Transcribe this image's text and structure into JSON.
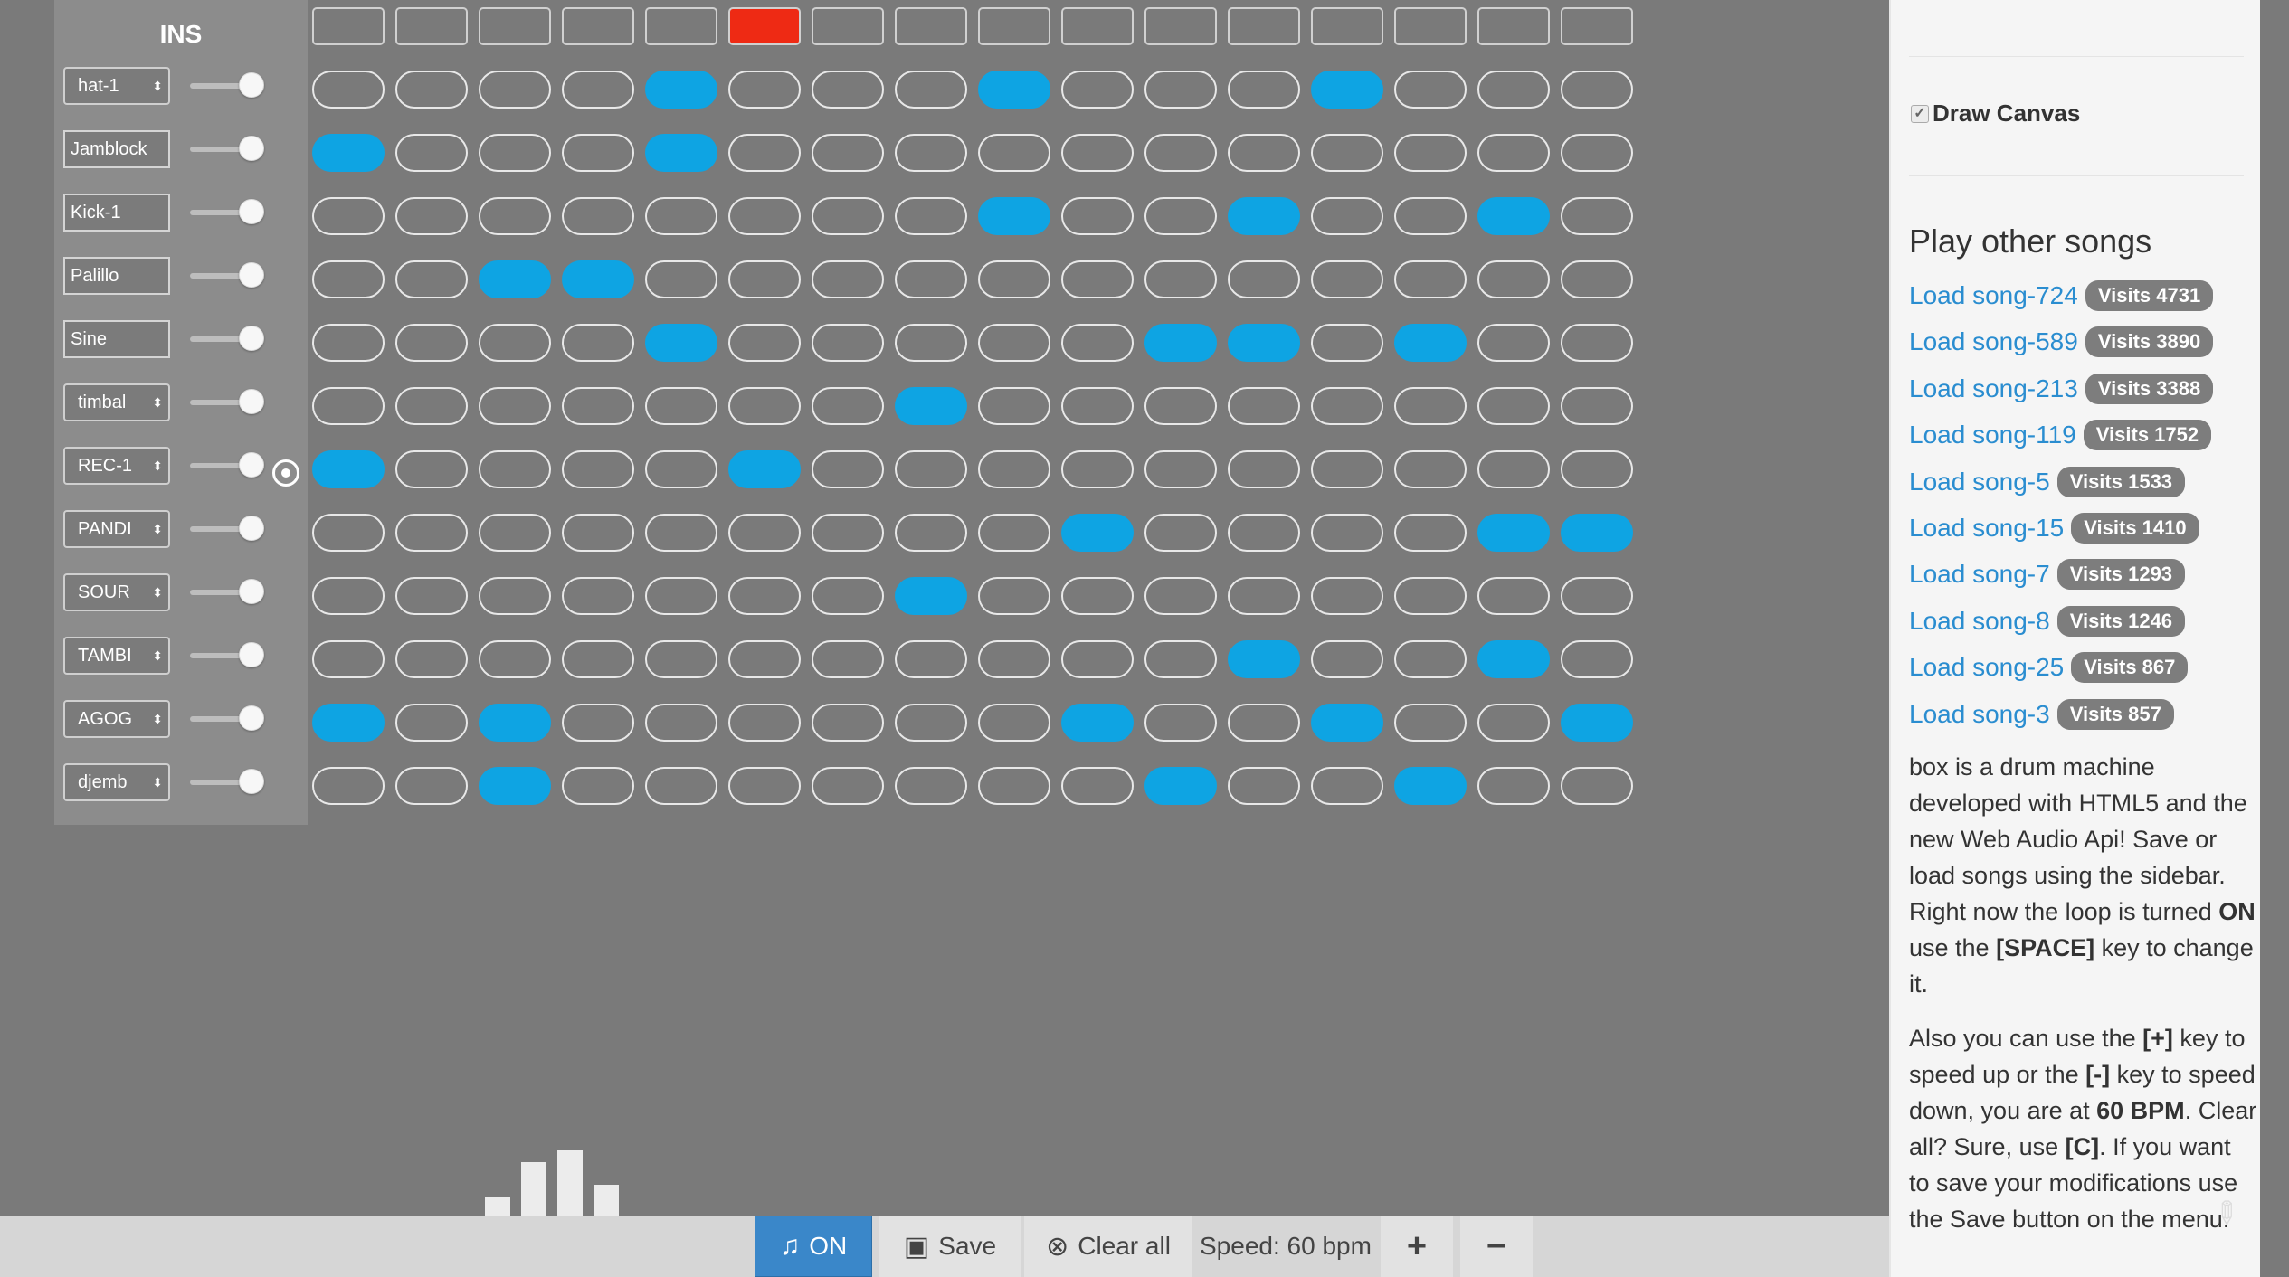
{
  "instruments": {
    "title": "INS",
    "rows": [
      {
        "name": "hat-1",
        "type": "select"
      },
      {
        "name": "Jamblock",
        "type": "field"
      },
      {
        "name": "Kick-1",
        "type": "field"
      },
      {
        "name": "Palillo",
        "type": "field"
      },
      {
        "name": "Sine",
        "type": "field"
      },
      {
        "name": "timbal",
        "type": "select"
      },
      {
        "name": "REC-1",
        "type": "select"
      },
      {
        "name": "PANDI",
        "type": "select"
      },
      {
        "name": "SOUR",
        "type": "select"
      },
      {
        "name": "TAMBI",
        "type": "select"
      },
      {
        "name": "AGOG",
        "type": "select"
      },
      {
        "name": "djemb",
        "type": "select"
      }
    ]
  },
  "sequencer": {
    "steps": 16,
    "current_step": 5,
    "active_color": "#0ea4e3",
    "indicator_color": "#ee2a14",
    "pattern": [
      [
        4,
        8,
        12
      ],
      [
        0,
        4
      ],
      [
        8,
        11,
        14
      ],
      [
        2,
        3
      ],
      [
        4,
        10,
        11,
        13
      ],
      [
        7
      ],
      [
        0,
        5
      ],
      [
        9,
        14,
        15
      ],
      [
        7
      ],
      [
        11,
        14
      ],
      [
        0,
        2,
        9,
        12,
        15
      ],
      [
        2,
        10,
        13
      ]
    ]
  },
  "equalizer": {
    "levels": [
      0.22,
      0.65,
      0.8,
      0.38
    ]
  },
  "toolbar": {
    "on_label": "ON",
    "save_label": "Save",
    "clear_label": "Clear all",
    "speed_label": "Speed: 60 bpm",
    "plus_label": "+",
    "minus_label": "−"
  },
  "sidebar": {
    "draw_canvas_label": "Draw Canvas",
    "draw_canvas_checked": true,
    "songs_title": "Play other songs",
    "songs": [
      {
        "label": "Load song-724",
        "visits": "Visits 4731"
      },
      {
        "label": "Load song-589",
        "visits": "Visits 3890"
      },
      {
        "label": "Load song-213",
        "visits": "Visits 3388"
      },
      {
        "label": "Load song-119",
        "visits": "Visits 1752"
      },
      {
        "label": "Load song-5",
        "visits": "Visits 1533"
      },
      {
        "label": "Load song-15",
        "visits": "Visits 1410"
      },
      {
        "label": "Load song-7",
        "visits": "Visits 1293"
      },
      {
        "label": "Load song-8",
        "visits": "Visits 1246"
      },
      {
        "label": "Load song-25",
        "visits": "Visits 867"
      },
      {
        "label": "Load song-3",
        "visits": "Visits 857"
      }
    ],
    "about_1": {
      "t1": "box is a drum machine developed with HTML5 and the new Web Audio Api! Save or load songs using the sidebar. Right now the loop is turned ",
      "b1": "ON",
      "t2": " use the ",
      "b2": "[SPACE]",
      "t3": " key to change it."
    },
    "about_2": {
      "t1": "Also you can use the ",
      "b1": "[+]",
      "t2": " key to speed up or the ",
      "b2": "[-]",
      "t3": " key to speed down, you are at ",
      "b3": "60 BPM",
      "t4": ". Clear all? Sure, use ",
      "b4": "[C]",
      "t5": ". If you want to save your modifications use the Save button on the menu."
    }
  }
}
